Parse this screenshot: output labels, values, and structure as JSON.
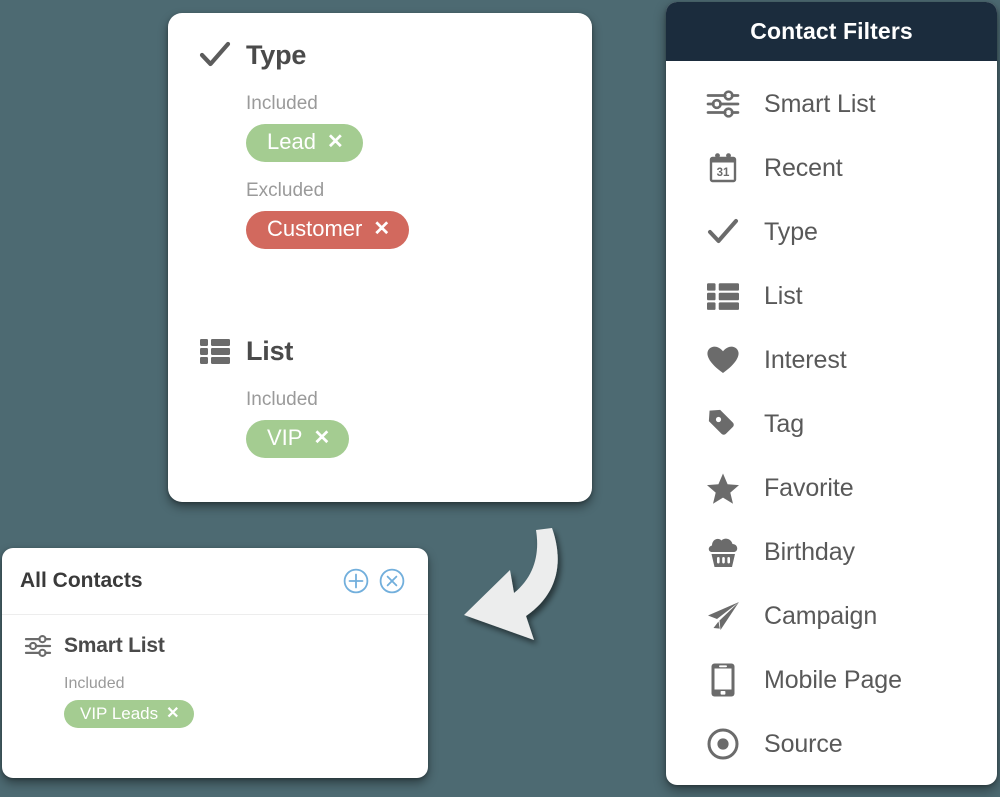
{
  "background_color": "#4d6a72",
  "filter_card": {
    "groups": [
      {
        "icon": "check-icon",
        "title": "Type",
        "sections": [
          {
            "label": "Included",
            "pills": [
              {
                "text": "Lead",
                "color": "#a4cc91",
                "remove": "✕"
              }
            ]
          },
          {
            "label": "Excluded",
            "pills": [
              {
                "text": "Customer",
                "color": "#d2695e",
                "remove": "✕"
              }
            ]
          }
        ]
      },
      {
        "icon": "list-icon",
        "title": "List",
        "sections": [
          {
            "label": "Included",
            "pills": [
              {
                "text": "VIP",
                "color": "#a4cc91",
                "remove": "✕"
              }
            ]
          }
        ]
      }
    ]
  },
  "all_contacts_card": {
    "title": "All Contacts",
    "add_icon": "plus-circle-icon",
    "close_icon": "close-circle-icon",
    "icon_color": "#72afdc",
    "group": {
      "icon": "sliders-icon",
      "title": "Smart List",
      "section_label": "Included",
      "pill": {
        "text": "VIP Leads",
        "color": "#a4cc91",
        "remove": "✕"
      }
    }
  },
  "sidebar": {
    "header_title": "Contact Filters",
    "header_color": "#1b2c3d",
    "items": [
      {
        "icon": "sliders-icon",
        "label": "Smart List"
      },
      {
        "icon": "calendar-31-icon",
        "label": "Recent"
      },
      {
        "icon": "check-icon",
        "label": "Type"
      },
      {
        "icon": "list-icon",
        "label": "List"
      },
      {
        "icon": "heart-icon",
        "label": "Interest"
      },
      {
        "icon": "tag-icon",
        "label": "Tag"
      },
      {
        "icon": "star-icon",
        "label": "Favorite"
      },
      {
        "icon": "cupcake-icon",
        "label": "Birthday"
      },
      {
        "icon": "paper-plane-icon",
        "label": "Campaign"
      },
      {
        "icon": "mobile-phone-icon",
        "label": "Mobile Page"
      },
      {
        "icon": "target-dot-icon",
        "label": "Source"
      }
    ]
  },
  "arrow": {
    "name": "curved-arrow-down-left",
    "color": "#eceded"
  }
}
